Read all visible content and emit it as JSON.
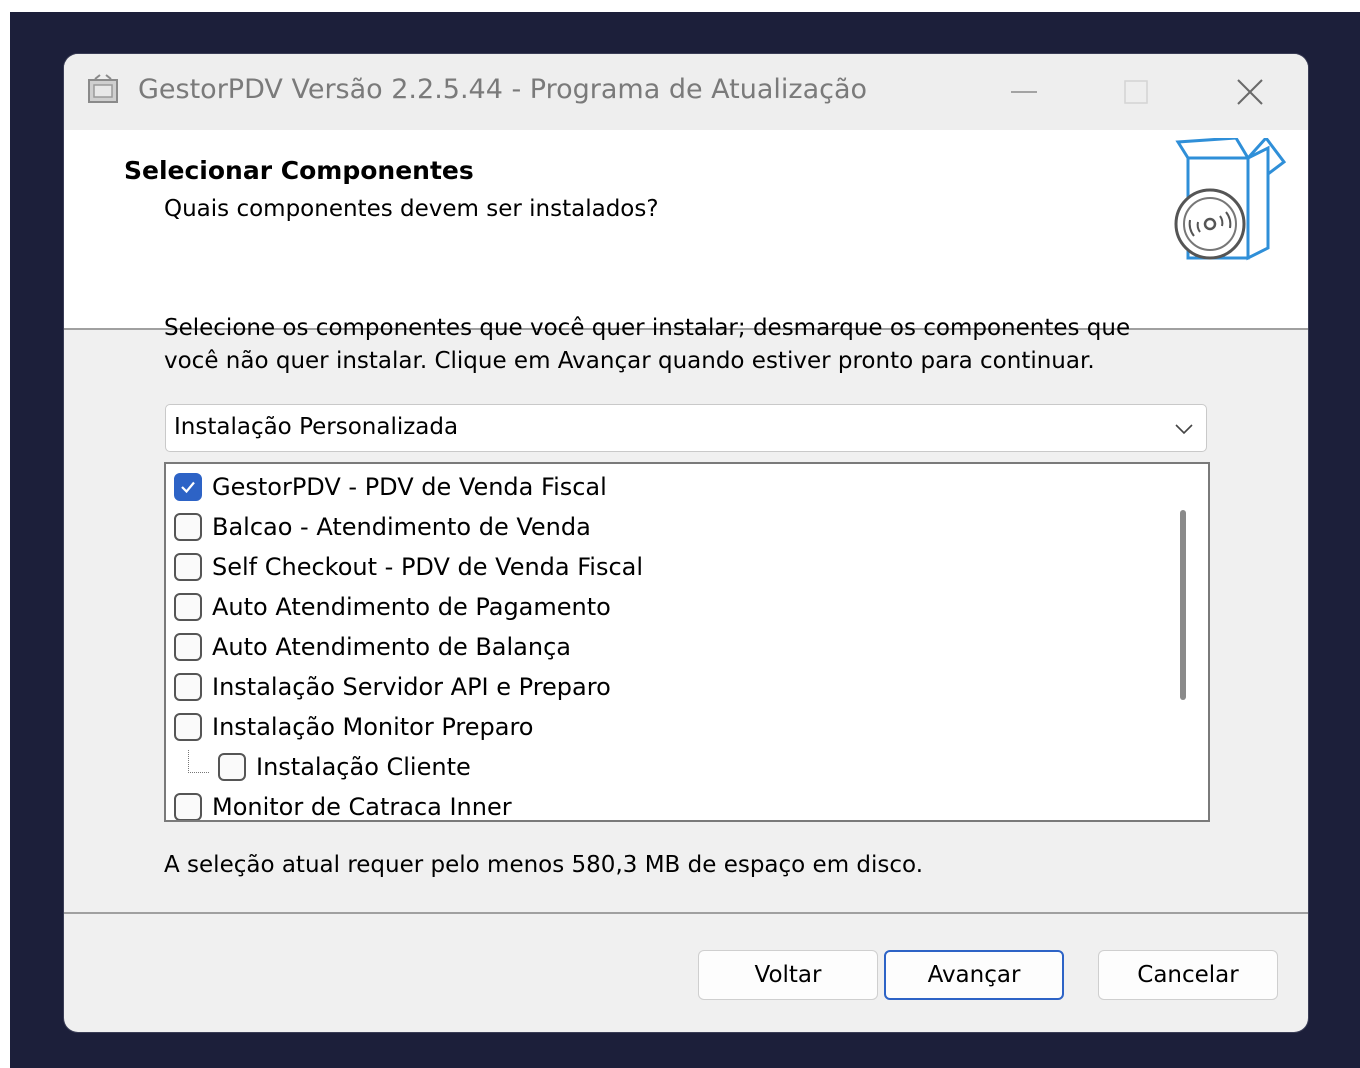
{
  "window": {
    "title": "GestorPDV Versão 2.2.5.44 - Programa de Atualização"
  },
  "header": {
    "title": "Selecionar Componentes",
    "subtitle": "Quais componentes devem ser instalados?"
  },
  "instructions": {
    "line1": "Selecione os componentes que você quer instalar; desmarque os componentes que",
    "line2": "você não quer instalar. Clique em Avançar quando estiver pronto para continuar."
  },
  "install_type": {
    "selected": "Instalação Personalizada"
  },
  "components": [
    {
      "label": "GestorPDV - PDV de Venda Fiscal",
      "checked": true
    },
    {
      "label": "Balcao - Atendimento de Venda",
      "checked": false
    },
    {
      "label": "Self Checkout - PDV de Venda Fiscal",
      "checked": false
    },
    {
      "label": "Auto Atendimento de Pagamento",
      "checked": false
    },
    {
      "label": "Auto Atendimento de Balança",
      "checked": false
    },
    {
      "label": "Instalação Servidor API e Preparo",
      "checked": false
    },
    {
      "label": "Instalação Monitor Preparo",
      "checked": false
    },
    {
      "label": "Instalação Cliente",
      "checked": false
    },
    {
      "label": "Monitor de Catraca Inner",
      "checked": false
    }
  ],
  "disk_space": "A seleção atual requer pelo menos 580,3 MB de espaço em disco.",
  "buttons": {
    "back": "Voltar",
    "next": "Avançar",
    "cancel": "Cancelar"
  },
  "colors": {
    "accent": "#2d63c6",
    "desktop": "#1c1f3a"
  }
}
